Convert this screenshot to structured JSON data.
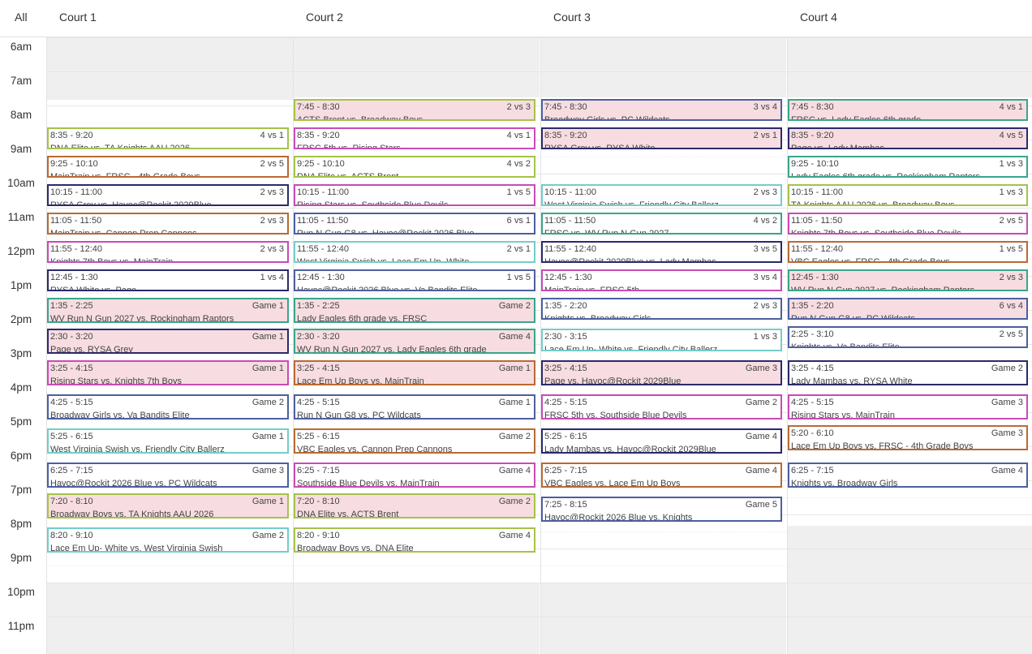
{
  "header": {
    "all_label": "All",
    "courts": [
      "Court 1",
      "Court 2",
      "Court 3",
      "Court 4"
    ]
  },
  "hours": [
    "6am",
    "7am",
    "8am",
    "9am",
    "10am",
    "11am",
    "12pm",
    "1pm",
    "2pm",
    "3pm",
    "4pm",
    "5pm",
    "6pm",
    "7pm",
    "8pm",
    "9pm",
    "10pm",
    "11pm"
  ],
  "colors": {
    "green": "#a6c24a",
    "purple": "#c84bb5",
    "orange": "#b96a33",
    "navy": "#2b2a6a",
    "teal": "#3aa58a",
    "blue": "#4c5fa0",
    "cyan": "#74cdc9",
    "highlight_bg": "#f7dde1",
    "closed_bg": "#efefef"
  },
  "courts": [
    {
      "name": "Court 1",
      "events": [
        {
          "time": "8:35 - 9:20",
          "label": "4 vs 1",
          "title": "DNA Elite vs. TA Knights AAU 2026",
          "color": "green",
          "start": "8:35",
          "end": "9:20",
          "highlight": false
        },
        {
          "time": "9:25 - 10:10",
          "label": "2 vs 5",
          "title": "MainTrain vs. FRSC - 4th Grade Boys",
          "color": "orange",
          "start": "9:25",
          "end": "10:10",
          "highlight": false
        },
        {
          "time": "10:15 - 11:00",
          "label": "2 vs 3",
          "title": "RYSA Grey vs. Havoc@Rockit 2029Blue",
          "color": "navy",
          "start": "10:15",
          "end": "11:00",
          "highlight": false
        },
        {
          "time": "11:05 - 11:50",
          "label": "2 vs 3",
          "title": "MainTrain vs. Cannon Prep Cannons",
          "color": "orange",
          "start": "11:05",
          "end": "11:50",
          "highlight": false
        },
        {
          "time": "11:55 - 12:40",
          "label": "2 vs 3",
          "title": "Knights 7th Boys vs. MainTrain",
          "color": "purple",
          "start": "11:55",
          "end": "12:40",
          "highlight": false
        },
        {
          "time": "12:45 - 1:30",
          "label": "1 vs 4",
          "title": "RYSA White vs. Page",
          "color": "navy",
          "start": "12:45",
          "end": "13:30",
          "highlight": false
        },
        {
          "time": "1:35 - 2:25",
          "label": "Game 1",
          "title": "WV Run N Gun 2027 vs. Rockingham Raptors",
          "color": "teal",
          "start": "13:35",
          "end": "14:25",
          "highlight": true
        },
        {
          "time": "2:30 - 3:20",
          "label": "Game 1",
          "title": "Page vs. RYSA Grey",
          "color": "navy",
          "start": "14:30",
          "end": "15:20",
          "highlight": true
        },
        {
          "time": "3:25 - 4:15",
          "label": "Game 1",
          "title": "Rising Stars vs. Knights 7th Boys",
          "color": "purple",
          "start": "15:25",
          "end": "16:15",
          "highlight": true
        },
        {
          "time": "4:25 - 5:15",
          "label": "Game 2",
          "title": "Broadway Girls vs. Va Bandits Elite",
          "color": "blue",
          "start": "16:25",
          "end": "17:15",
          "highlight": false
        },
        {
          "time": "5:25 - 6:15",
          "label": "Game 1",
          "title": "West Virginia Swish vs. Friendly City Ballerz",
          "color": "cyan",
          "start": "17:25",
          "end": "18:15",
          "highlight": false
        },
        {
          "time": "6:25 - 7:15",
          "label": "Game 3",
          "title": "Havoc@Rockit 2026 Blue vs. PC Wildcats",
          "color": "blue",
          "start": "18:25",
          "end": "19:15",
          "highlight": false
        },
        {
          "time": "7:20 - 8:10",
          "label": "Game 1",
          "title": "Broadway Boys vs. TA Knights AAU 2026",
          "color": "green",
          "start": "19:20",
          "end": "20:10",
          "highlight": true
        },
        {
          "time": "8:20 - 9:10",
          "label": "Game 2",
          "title": "Lace Em Up- White vs. West Virginia Swish",
          "color": "cyan",
          "start": "20:20",
          "end": "21:10",
          "highlight": false
        }
      ]
    },
    {
      "name": "Court 2",
      "events": [
        {
          "time": "7:45 - 8:30",
          "label": "2 vs 3",
          "title": "ACTS Brent vs. Broadway Boys",
          "color": "green",
          "start": "7:45",
          "end": "8:30",
          "highlight": true
        },
        {
          "time": "8:35 - 9:20",
          "label": "4 vs 1",
          "title": "FRSC 5th vs. Rising Stars",
          "color": "purple",
          "start": "8:35",
          "end": "9:20",
          "highlight": false
        },
        {
          "time": "9:25 - 10:10",
          "label": "4 vs 2",
          "title": "DNA Elite vs. ACTS Brent",
          "color": "green",
          "start": "9:25",
          "end": "10:10",
          "highlight": false
        },
        {
          "time": "10:15 - 11:00",
          "label": "1 vs 5",
          "title": "Rising Stars vs. Southside Blue Devils",
          "color": "purple",
          "start": "10:15",
          "end": "11:00",
          "highlight": false
        },
        {
          "time": "11:05 - 11:50",
          "label": "6 vs 1",
          "title": "Run N Gun G8 vs. Havoc@Rockit 2026 Blue",
          "color": "blue",
          "start": "11:05",
          "end": "11:50",
          "highlight": false
        },
        {
          "time": "11:55 - 12:40",
          "label": "2 vs 1",
          "title": "West Virginia Swish vs. Lace Em Up- White",
          "color": "cyan",
          "start": "11:55",
          "end": "12:40",
          "highlight": false
        },
        {
          "time": "12:45 - 1:30",
          "label": "1 vs 5",
          "title": "Havoc@Rockit 2026 Blue vs. Va Bandits Elite",
          "color": "blue",
          "start": "12:45",
          "end": "13:30",
          "highlight": false
        },
        {
          "time": "1:35 - 2:25",
          "label": "Game 2",
          "title": "Lady Eagles 6th grade vs. FRSC",
          "color": "teal",
          "start": "13:35",
          "end": "14:25",
          "highlight": true
        },
        {
          "time": "2:30 - 3:20",
          "label": "Game 4",
          "title": "WV Run N Gun 2027 vs. Lady Eagles 6th grade",
          "color": "teal",
          "start": "14:30",
          "end": "15:20",
          "highlight": true
        },
        {
          "time": "3:25 - 4:15",
          "label": "Game 1",
          "title": "Lace Em Up Boys vs. MainTrain",
          "color": "orange",
          "start": "15:25",
          "end": "16:15",
          "highlight": true
        },
        {
          "time": "4:25 - 5:15",
          "label": "Game 1",
          "title": "Run N Gun G8 vs. PC Wildcats",
          "color": "blue",
          "start": "16:25",
          "end": "17:15",
          "highlight": false
        },
        {
          "time": "5:25 - 6:15",
          "label": "Game 2",
          "title": "VBC Eagles vs. Cannon Prep Cannons",
          "color": "orange",
          "start": "17:25",
          "end": "18:15",
          "highlight": false
        },
        {
          "time": "6:25 - 7:15",
          "label": "Game 4",
          "title": "Southside Blue Devils vs. MainTrain",
          "color": "purple",
          "start": "18:25",
          "end": "19:15",
          "highlight": false
        },
        {
          "time": "7:20 - 8:10",
          "label": "Game 2",
          "title": "DNA Elite vs. ACTS Brent",
          "color": "green",
          "start": "19:20",
          "end": "20:10",
          "highlight": true
        },
        {
          "time": "8:20 - 9:10",
          "label": "Game 4",
          "title": "Broadway Boys vs. DNA Elite",
          "color": "green",
          "start": "20:20",
          "end": "21:10",
          "highlight": false
        }
      ]
    },
    {
      "name": "Court 3",
      "events": [
        {
          "time": "7:45 - 8:30",
          "label": "3 vs 4",
          "title": "Broadway Girls vs. PC Wildcats",
          "color": "blue",
          "start": "7:45",
          "end": "8:30",
          "highlight": true
        },
        {
          "time": "8:35 - 9:20",
          "label": "2 vs 1",
          "title": "RYSA Grey vs. RYSA White",
          "color": "navy",
          "start": "8:35",
          "end": "9:20",
          "highlight": true
        },
        {
          "time": "10:15 - 11:00",
          "label": "2 vs 3",
          "title": "West Virginia Swish vs. Friendly City Ballerz",
          "color": "cyan",
          "start": "10:15",
          "end": "11:00",
          "highlight": false
        },
        {
          "time": "11:05 - 11:50",
          "label": "4 vs 2",
          "title": "FRSC vs. WV Run N Gun 2027",
          "color": "teal",
          "start": "11:05",
          "end": "11:50",
          "highlight": false
        },
        {
          "time": "11:55 - 12:40",
          "label": "3 vs 5",
          "title": "Havoc@Rockit 2029Blue vs. Lady Mambas",
          "color": "navy",
          "start": "11:55",
          "end": "12:40",
          "highlight": false
        },
        {
          "time": "12:45 - 1:30",
          "label": "3 vs 4",
          "title": "MainTrain vs. FRSC 5th",
          "color": "purple",
          "start": "12:45",
          "end": "13:30",
          "highlight": false
        },
        {
          "time": "1:35 - 2:20",
          "label": "2 vs 3",
          "title": "Knights vs. Broadway Girls",
          "color": "blue",
          "start": "13:35",
          "end": "14:20",
          "highlight": false
        },
        {
          "time": "2:30 - 3:15",
          "label": "1 vs 3",
          "title": "Lace Em Up- White vs. Friendly City Ballerz",
          "color": "cyan",
          "start": "14:30",
          "end": "15:15",
          "highlight": false
        },
        {
          "time": "3:25 - 4:15",
          "label": "Game 3",
          "title": "Page vs. Havoc@Rockit 2029Blue",
          "color": "navy",
          "start": "15:25",
          "end": "16:15",
          "highlight": true
        },
        {
          "time": "4:25 - 5:15",
          "label": "Game 2",
          "title": "FRSC 5th vs. Southside Blue Devils",
          "color": "purple",
          "start": "16:25",
          "end": "17:15",
          "highlight": false
        },
        {
          "time": "5:25 - 6:15",
          "label": "Game 4",
          "title": "Lady Mambas vs. Havoc@Rockit 2029Blue",
          "color": "navy",
          "start": "17:25",
          "end": "18:15",
          "highlight": false
        },
        {
          "time": "6:25 - 7:15",
          "label": "Game 4",
          "title": "VBC Eagles vs. Lace Em Up Boys",
          "color": "orange",
          "start": "18:25",
          "end": "19:15",
          "highlight": false
        },
        {
          "time": "7:25 - 8:15",
          "label": "Game 5",
          "title": "Havoc@Rockit 2026 Blue vs. Knights",
          "color": "blue",
          "start": "19:25",
          "end": "20:15",
          "highlight": false
        }
      ]
    },
    {
      "name": "Court 4",
      "events": [
        {
          "time": "7:45 - 8:30",
          "label": "4 vs 1",
          "title": "FRSC vs. Lady Eagles 6th grade",
          "color": "teal",
          "start": "7:45",
          "end": "8:30",
          "highlight": true
        },
        {
          "time": "8:35 - 9:20",
          "label": "4 vs 5",
          "title": "Page vs. Lady Mambas",
          "color": "navy",
          "start": "8:35",
          "end": "9:20",
          "highlight": true
        },
        {
          "time": "9:25 - 10:10",
          "label": "1 vs 3",
          "title": "Lady Eagles 6th grade vs. Rockingham Raptors",
          "color": "teal",
          "start": "9:25",
          "end": "10:10",
          "highlight": false
        },
        {
          "time": "10:15 - 11:00",
          "label": "1 vs 3",
          "title": "TA Knights AAU 2026 vs. Broadway Boys",
          "color": "green",
          "start": "10:15",
          "end": "11:00",
          "highlight": false
        },
        {
          "time": "11:05 - 11:50",
          "label": "2 vs 5",
          "title": "Knights 7th Boys vs. Southside Blue Devils",
          "color": "purple",
          "start": "11:05",
          "end": "11:50",
          "highlight": false
        },
        {
          "time": "11:55 - 12:40",
          "label": "1 vs 5",
          "title": "VBC Eagles vs. FRSC - 4th Grade Boys",
          "color": "orange",
          "start": "11:55",
          "end": "12:40",
          "highlight": false
        },
        {
          "time": "12:45 - 1:30",
          "label": "2 vs 3",
          "title": "WV Run N Gun 2027 vs. Rockingham Raptors",
          "color": "teal",
          "start": "12:45",
          "end": "13:30",
          "highlight": true
        },
        {
          "time": "1:35 - 2:20",
          "label": "6 vs 4",
          "title": "Run N Gun G8 vs. PC Wildcats",
          "color": "blue",
          "start": "13:35",
          "end": "14:20",
          "highlight": true
        },
        {
          "time": "2:25 - 3:10",
          "label": "2 vs 5",
          "title": "Knights vs. Va Bandits Elite",
          "color": "blue",
          "start": "14:25",
          "end": "15:10",
          "highlight": false
        },
        {
          "time": "3:25 - 4:15",
          "label": "Game 2",
          "title": "Lady Mambas vs. RYSA White",
          "color": "navy",
          "start": "15:25",
          "end": "16:15",
          "highlight": false
        },
        {
          "time": "4:25 - 5:15",
          "label": "Game 3",
          "title": "Rising Stars vs. MainTrain",
          "color": "purple",
          "start": "16:25",
          "end": "17:15",
          "highlight": false
        },
        {
          "time": "5:20 - 6:10",
          "label": "Game 3",
          "title": "Lace Em Up Boys vs. FRSC - 4th Grade Boys",
          "color": "orange",
          "start": "17:20",
          "end": "18:10",
          "highlight": false
        },
        {
          "time": "6:25 - 7:15",
          "label": "Game 4",
          "title": "Knights vs. Broadway Girls",
          "color": "blue",
          "start": "18:25",
          "end": "19:15",
          "highlight": false
        }
      ]
    }
  ]
}
